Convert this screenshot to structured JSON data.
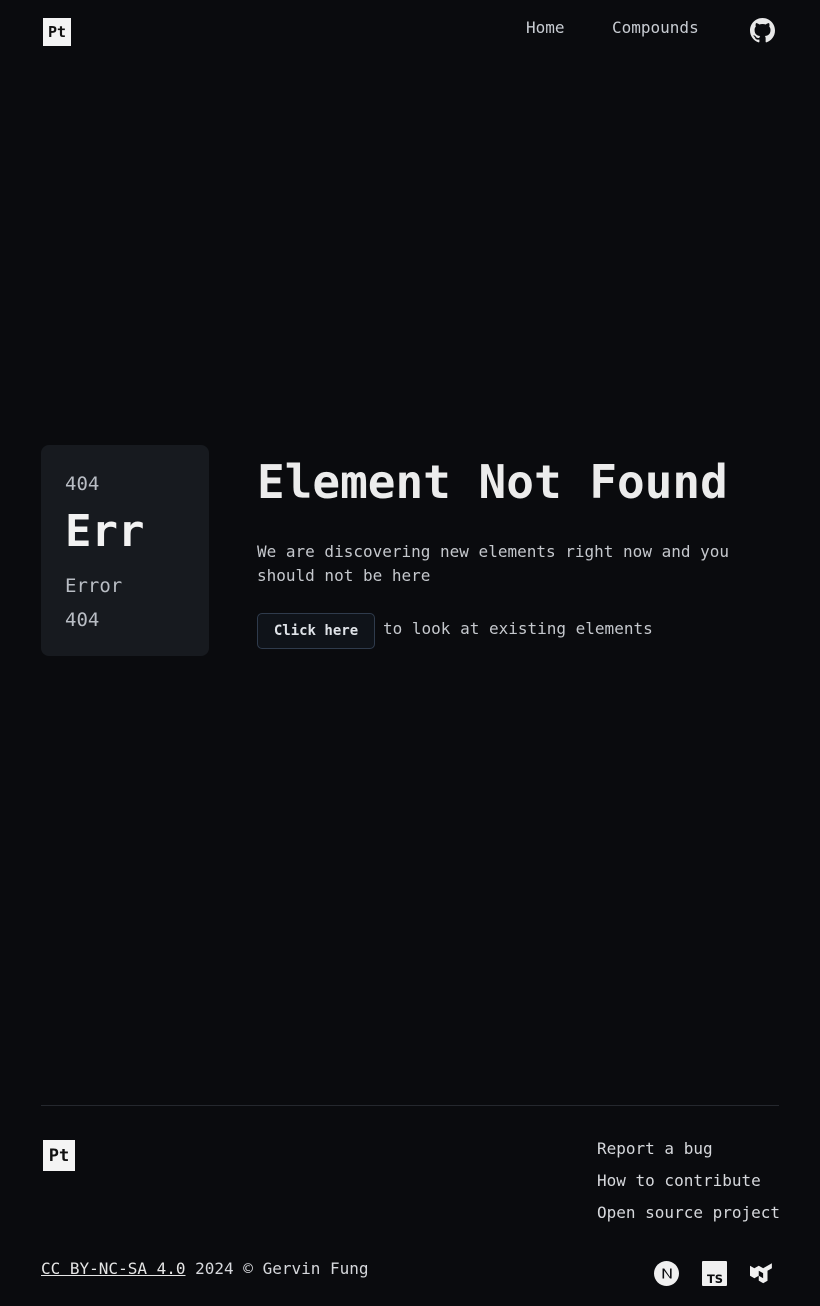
{
  "header": {
    "logo_text": "Pt",
    "nav": {
      "home": "Home",
      "compounds": "Compounds"
    },
    "github_icon": "github-icon"
  },
  "card": {
    "number": "404",
    "symbol": "Err",
    "name": "Error 404"
  },
  "main": {
    "title": "Element Not Found",
    "description": "We are discovering new elements right now and you should not be here",
    "button_label": "Click here",
    "cta_text": "to look at existing elements"
  },
  "footer": {
    "logo_text": "Pt",
    "links": [
      "Report a bug",
      "How to contribute",
      "Open source project"
    ],
    "license": "CC BY-NC-SA 4.0",
    "copyright": "2024 © Gervin Fung",
    "tech_icons": [
      "nextjs-icon",
      "typescript-icon",
      "mui-icon"
    ]
  },
  "colors": {
    "background": "#0a0b0e",
    "card": "#171a1f",
    "button_border": "#2f3b4c"
  }
}
